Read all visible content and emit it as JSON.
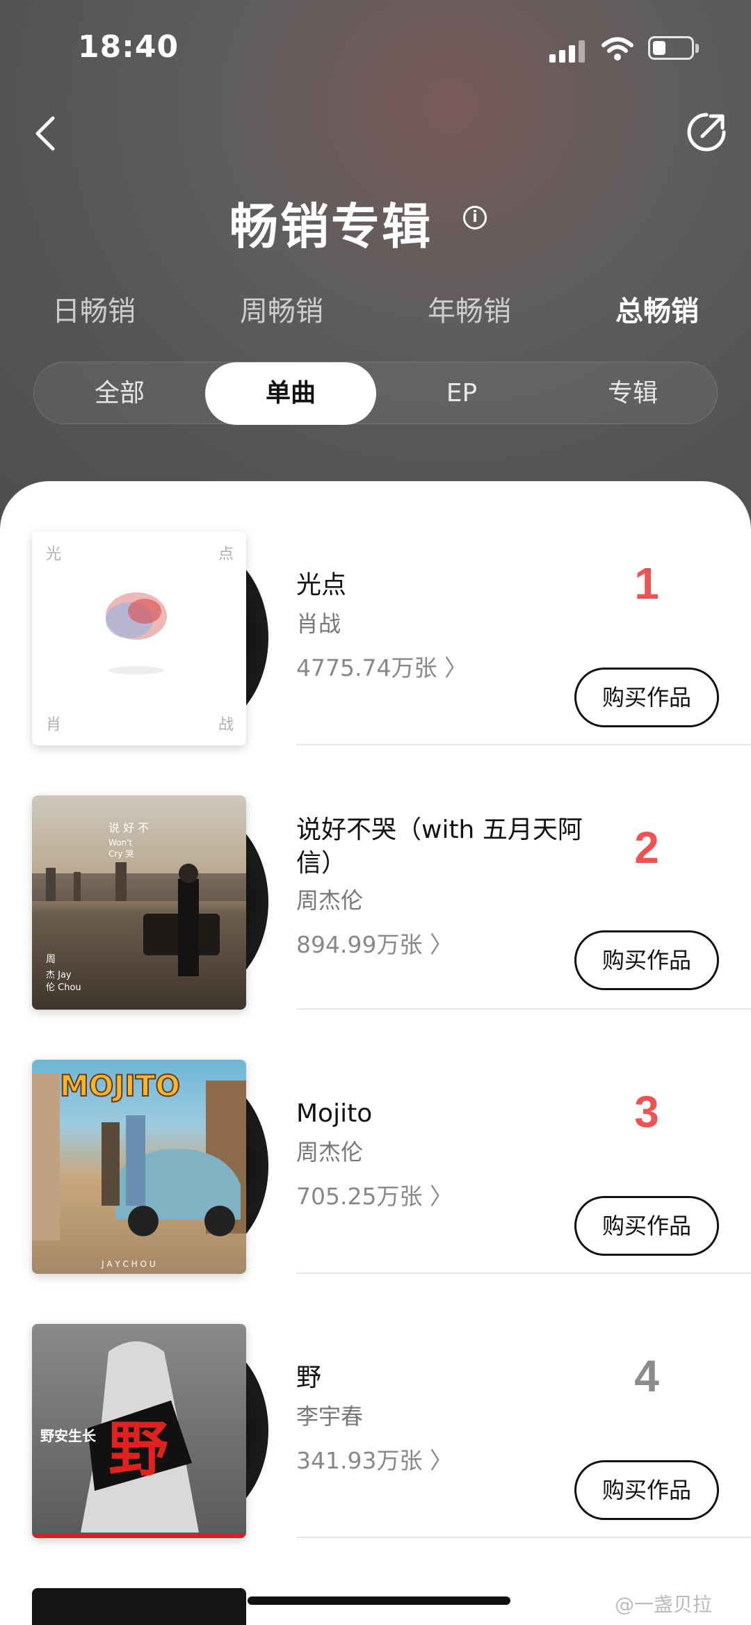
{
  "status_bar": {
    "time": "18:40",
    "battery_level": 0.35
  },
  "header": {
    "title": "畅销专辑",
    "info_icon": "i"
  },
  "period_tabs": [
    {
      "label": "日畅销",
      "active": false
    },
    {
      "label": "周畅销",
      "active": false
    },
    {
      "label": "年畅销",
      "active": false
    },
    {
      "label": "总畅销",
      "active": true
    }
  ],
  "type_tabs": [
    {
      "label": "全部",
      "active": false
    },
    {
      "label": "单曲",
      "active": true
    },
    {
      "label": "EP",
      "active": false
    },
    {
      "label": "专辑",
      "active": false
    }
  ],
  "items": [
    {
      "rank": "1",
      "rank_color": "#ec5453",
      "title": "光点",
      "artist": "肖战",
      "sales": "4775.74万张",
      "buy_label": "购买作品",
      "cover_text": {
        "tl": "光",
        "tr": "点",
        "bl": "肖",
        "br": "战"
      }
    },
    {
      "rank": "2",
      "rank_color": "#ec5453",
      "title": "说好不哭（with 五月天阿信）",
      "artist": "周杰伦",
      "sales": "894.99万张",
      "buy_label": "购买作品",
      "cover_text": {
        "title": "说 好 不\nWon't\nCry  哭",
        "artist": "周\n杰 Jay\n伦 Chou"
      }
    },
    {
      "rank": "3",
      "rank_color": "#ec5453",
      "title": "Mojito",
      "artist": "周杰伦",
      "sales": "705.25万张",
      "buy_label": "购买作品",
      "cover_text": {
        "title": "MOJITO",
        "footer": "J A Y   C H O U"
      }
    },
    {
      "rank": "4",
      "rank_color": "#8c8c8c",
      "title": "野",
      "artist": "李宇春",
      "sales": "341.93万张",
      "buy_label": "购买作品",
      "cover_text": {
        "title": "野",
        "side": "野安生长"
      }
    }
  ],
  "watermark": "@一盏贝拉"
}
